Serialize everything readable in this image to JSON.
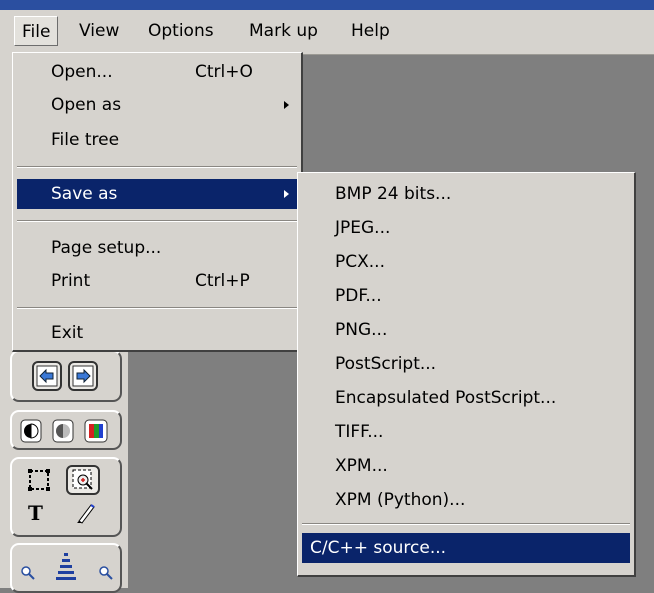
{
  "menubar": {
    "items": [
      "File",
      "View",
      "Options",
      "Mark up",
      "Help"
    ]
  },
  "file_menu": {
    "open": {
      "label": "Open...",
      "shortcut": "Ctrl+O"
    },
    "open_as": {
      "label": "Open as"
    },
    "file_tree": {
      "label": "File tree"
    },
    "save_as": {
      "label": "Save as"
    },
    "page_setup": {
      "label": "Page setup..."
    },
    "print": {
      "label": "Print",
      "shortcut": "Ctrl+P"
    },
    "exit": {
      "label": "Exit"
    }
  },
  "save_as_submenu": {
    "items": [
      "BMP 24 bits...",
      "JPEG...",
      "PCX...",
      "PDF...",
      "PNG...",
      "PostScript...",
      "Encapsulated PostScript...",
      "TIFF...",
      "XPM...",
      "XPM (Python)...",
      "C/C++ source..."
    ]
  },
  "toolbar": {
    "text_tool_glyph": "T"
  },
  "colors": {
    "highlight": "#0a246a",
    "menu_bg": "#d6d3ce",
    "canvas_bg": "#7f7f7f"
  }
}
